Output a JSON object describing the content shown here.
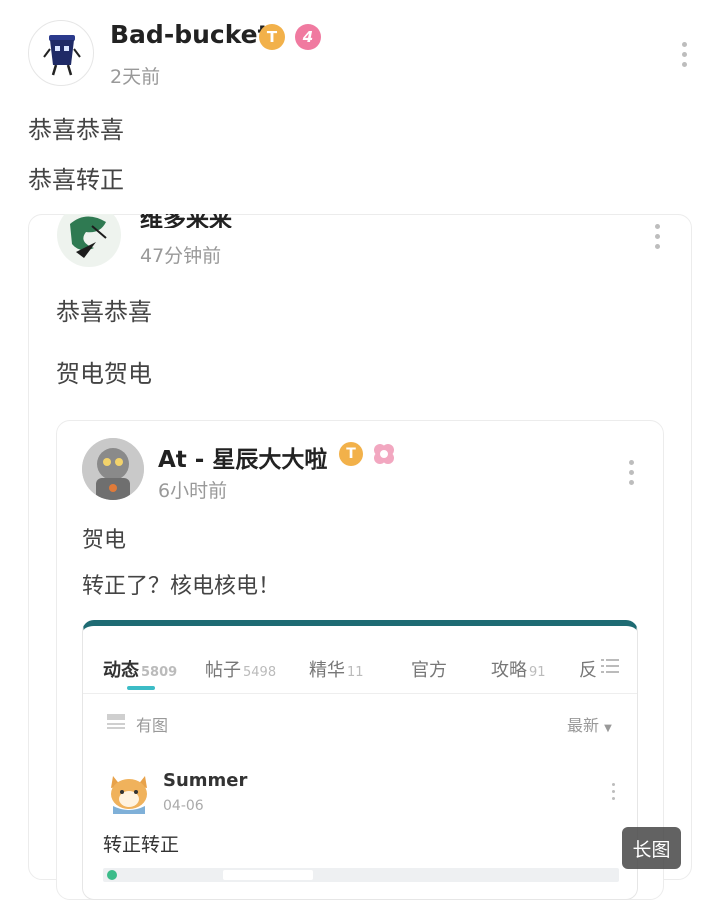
{
  "post": {
    "author": "Bad-bucket",
    "badge_t": "T",
    "level": "4",
    "time": "2天前",
    "lines": [
      "恭喜恭喜",
      "恭喜转正"
    ]
  },
  "quote1": {
    "author": "维多来来",
    "time": "47分钟前",
    "lines": [
      "恭喜恭喜",
      "贺电贺电"
    ]
  },
  "quote2": {
    "author": "At - 星辰大大啦",
    "badge_t": "T",
    "time": "6小时前",
    "lines": [
      "贺电",
      "转正了？核电核电！"
    ]
  },
  "inner": {
    "tabs": [
      {
        "label": "动态",
        "count": "5809"
      },
      {
        "label": "帖子",
        "count": "5498"
      },
      {
        "label": "精华",
        "count": "11"
      },
      {
        "label": "官方",
        "count": ""
      },
      {
        "label": "攻略",
        "count": "91"
      },
      {
        "label": "反",
        "count": ""
      }
    ],
    "filter_label": "有图",
    "sort_label": "最新",
    "user": "Summer",
    "date": "04-06",
    "text": "转正转正"
  },
  "long_image_label": "长图",
  "colors": {
    "accent_teal": "#1e6b73",
    "badge_gold": "#f2b14a",
    "badge_pink": "#f07aa0"
  }
}
